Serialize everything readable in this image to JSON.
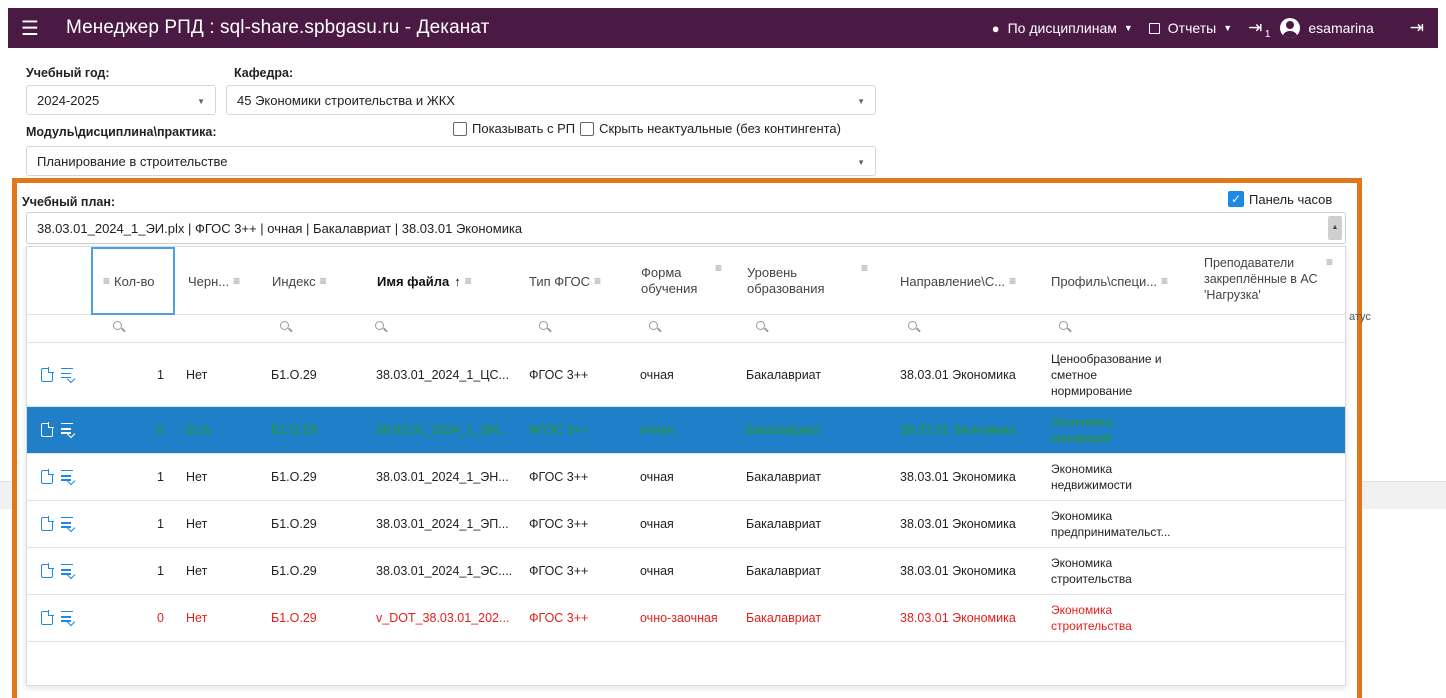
{
  "header": {
    "app_title": "Менеджер РПД : sql-share.spbgasu.ru - Деканат",
    "by_disciplines": "По дисциплинам",
    "reports": "Отчеты",
    "doc_count": "1",
    "username": "esamarina"
  },
  "filters": {
    "year_label": "Учебный год:",
    "year_value": "2024-2025",
    "dept_label": "Кафедра:",
    "dept_value": "45 Экономики строительства и ЖКХ",
    "module_label": "Модуль\\дисциплина\\практика:",
    "show_with_rp": "Показывать с РП",
    "hide_irrelevant": "Скрыть неактуальные (без контингента)",
    "discipline_value": "Планирование в строительстве"
  },
  "plan": {
    "label": "Учебный план:",
    "hours_panel": "Панель часов",
    "value": "38.03.01_2024_1_ЭИ.plx   | ФГОС 3++ | очная | Бакалавриат | 38.03.01 Экономика"
  },
  "background": {
    "status_fragment": "атус"
  },
  "grid": {
    "columns": {
      "qty": "Кол-во",
      "draft": "Черн...",
      "index": "Индекс",
      "filename": "Имя файла",
      "fgos": "Тип ФГОС",
      "form": "Форма обучения",
      "level": "Уровень образования",
      "direction": "Направление\\С...",
      "profile": "Профиль\\специ...",
      "teachers": "Преподаватели закреплённые в АС 'Нагрузка'"
    },
    "rows": [
      {
        "qty": "1",
        "draft": "Нет",
        "index": "Б1.О.29",
        "filename": "38.03.01_2024_1_ЦС...",
        "fgos": "ФГОС 3++",
        "form": "очная",
        "level": "Бакалавриат",
        "direction": "38.03.01 Экономика",
        "profile": "Ценообразование и сметное нормирование"
      },
      {
        "qty": "0",
        "draft": "Есть",
        "index": "Б1.О.29",
        "filename": "38.03.01_2024_1_ЭИ...",
        "fgos": "ФГОС 3++",
        "form": "очная",
        "level": "Бакалавриат",
        "direction": "38.03.01 Экономика",
        "profile": "Экономика инноваций"
      },
      {
        "qty": "1",
        "draft": "Нет",
        "index": "Б1.О.29",
        "filename": "38.03.01_2024_1_ЭН...",
        "fgos": "ФГОС 3++",
        "form": "очная",
        "level": "Бакалавриат",
        "direction": "38.03.01 Экономика",
        "profile": "Экономика недвижимости"
      },
      {
        "qty": "1",
        "draft": "Нет",
        "index": "Б1.О.29",
        "filename": "38.03.01_2024_1_ЭП...",
        "fgos": "ФГОС 3++",
        "form": "очная",
        "level": "Бакалавриат",
        "direction": "38.03.01 Экономика",
        "profile": "Экономика предпринимательст..."
      },
      {
        "qty": "1",
        "draft": "Нет",
        "index": "Б1.О.29",
        "filename": "38.03.01_2024_1_ЭС....",
        "fgos": "ФГОС 3++",
        "form": "очная",
        "level": "Бакалавриат",
        "direction": "38.03.01 Экономика",
        "profile": "Экономика строительства"
      },
      {
        "qty": "0",
        "draft": "Нет",
        "index": "Б1.О.29",
        "filename": "v_DOT_38.03.01_202...",
        "fgos": "ФГОС 3++",
        "form": "очно-заочная",
        "level": "Бакалавриат",
        "direction": "38.03.01 Экономика",
        "profile": "Экономика строительства"
      }
    ]
  }
}
